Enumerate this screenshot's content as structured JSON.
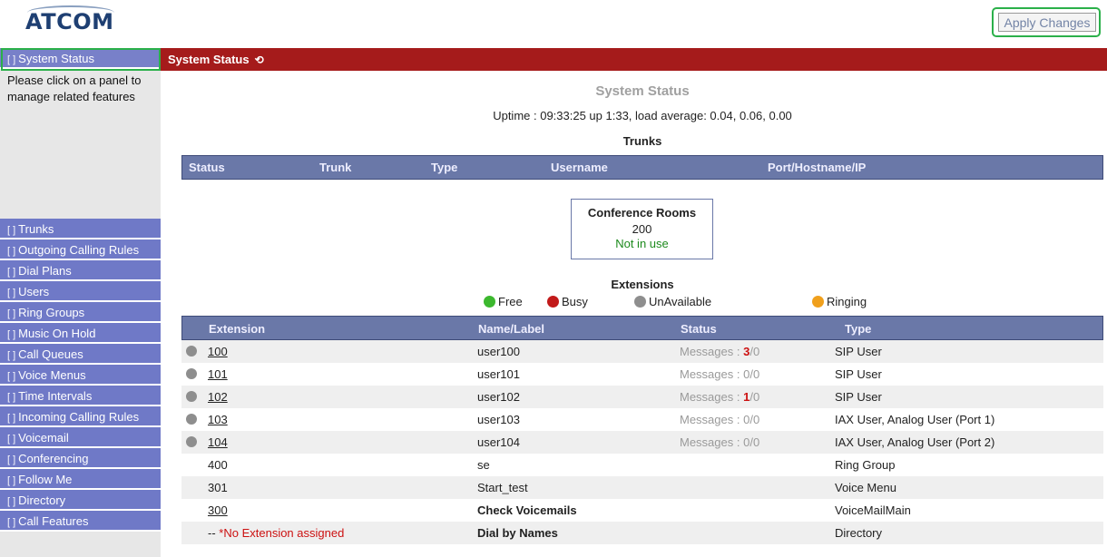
{
  "header": {
    "logo": "ATCOM",
    "apply_label": "Apply Changes"
  },
  "sidebar": {
    "active_item": "System Status",
    "help_text": "Please click on a panel to manage related features",
    "items": [
      "Trunks",
      "Outgoing Calling Rules",
      "Dial Plans",
      "Users",
      "Ring Groups",
      "Music On Hold",
      "Call Queues",
      "Voice Menus",
      "Time Intervals",
      "Incoming Calling Rules",
      "Voicemail",
      "Conferencing",
      "Follow Me",
      "Directory",
      "Call Features"
    ]
  },
  "titlebar": {
    "title": "System Status",
    "refresh_icon": "refresh-icon"
  },
  "main": {
    "title": "System Status",
    "uptime": "Uptime : 09:33:25 up 1:33, load average: 0.04, 0.06, 0.00",
    "trunks": {
      "title": "Trunks",
      "columns": [
        "Status",
        "Trunk",
        "Type",
        "Username",
        "Port/Hostname/IP"
      ]
    },
    "conference": {
      "title": "Conference Rooms",
      "room": "200",
      "status": "Not in use"
    },
    "extensions": {
      "title": "Extensions",
      "legend": [
        {
          "label": "Free",
          "color": "#3cb82e"
        },
        {
          "label": "Busy",
          "color": "#c21a1a"
        },
        {
          "label": "UnAvailable",
          "color": "#8e8e8e"
        },
        {
          "label": "Ringing",
          "color": "#f0a01c"
        }
      ],
      "columns": [
        "Extension",
        "Name/Label",
        "Status",
        "Type"
      ],
      "rows": [
        {
          "ext": "100",
          "name": "user100",
          "msg_prefix": "Messages : ",
          "msg_new": "3",
          "msg_rest": "/0",
          "type": "SIP User"
        },
        {
          "ext": "101",
          "name": "user101",
          "msg_prefix": "Messages : ",
          "msg_new": "0",
          "msg_rest": "/0",
          "type": "SIP User"
        },
        {
          "ext": "102",
          "name": "user102",
          "msg_prefix": "Messages : ",
          "msg_new": "1",
          "msg_rest": "/0",
          "type": "SIP User"
        },
        {
          "ext": "103",
          "name": "user103",
          "msg_prefix": "Messages : ",
          "msg_new": "0",
          "msg_rest": "/0",
          "type": "IAX User, Analog User (Port 1)"
        },
        {
          "ext": "104",
          "name": "user104",
          "msg_prefix": "Messages : ",
          "msg_new": "0",
          "msg_rest": "/0",
          "type": "IAX User, Analog User (Port 2)"
        },
        {
          "ext": "400",
          "name": "se",
          "type": "Ring Group"
        },
        {
          "ext": "301",
          "name": "Start_test",
          "type": "Voice Menu"
        },
        {
          "ext": "300",
          "name": "Check Voicemails",
          "type": "VoiceMailMain"
        },
        {
          "ext": "-- *No Extension assigned",
          "name": "Dial by Names",
          "type": "Directory"
        }
      ]
    }
  }
}
